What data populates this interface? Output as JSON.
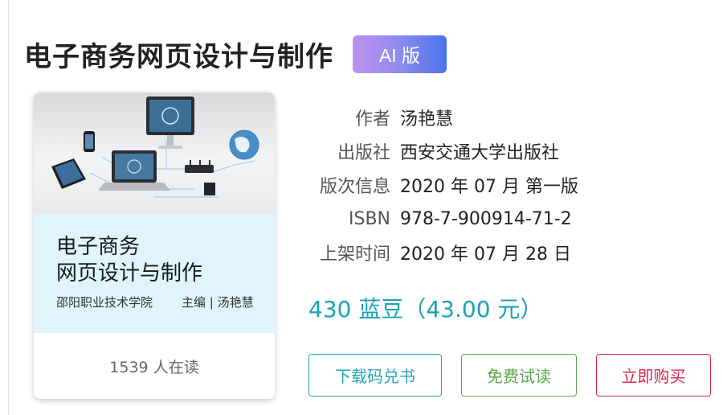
{
  "book": {
    "title": "电子商务网页设计与制作",
    "badge": "AI 版"
  },
  "cover": {
    "title_line1": "电子商务",
    "title_line2": "网页设计与制作",
    "publisher": "邵阳职业技术学院",
    "editor": "主编 | 汤艳慧",
    "readers": "1539 人在读"
  },
  "meta": [
    {
      "label": "作者",
      "value": "汤艳慧"
    },
    {
      "label": "出版社",
      "value": "西安交通大学出版社"
    },
    {
      "label": "版次信息",
      "value": "2020 年 07 月 第一版"
    },
    {
      "label": "ISBN",
      "value": "978-7-900914-71-2"
    },
    {
      "label": "上架时间",
      "value": "2020 年 07 月 28 日"
    }
  ],
  "price": "430 蓝豆（43.00 元）",
  "buttons": {
    "download": "下载码兑书",
    "trial": "免费试读",
    "buy": "立即购买"
  },
  "colors": {
    "price": "#19a3b6",
    "download": "#26a4b4",
    "trial": "#5ca64f",
    "buy": "#d9274b",
    "cover_panel": "#dff4fb"
  }
}
